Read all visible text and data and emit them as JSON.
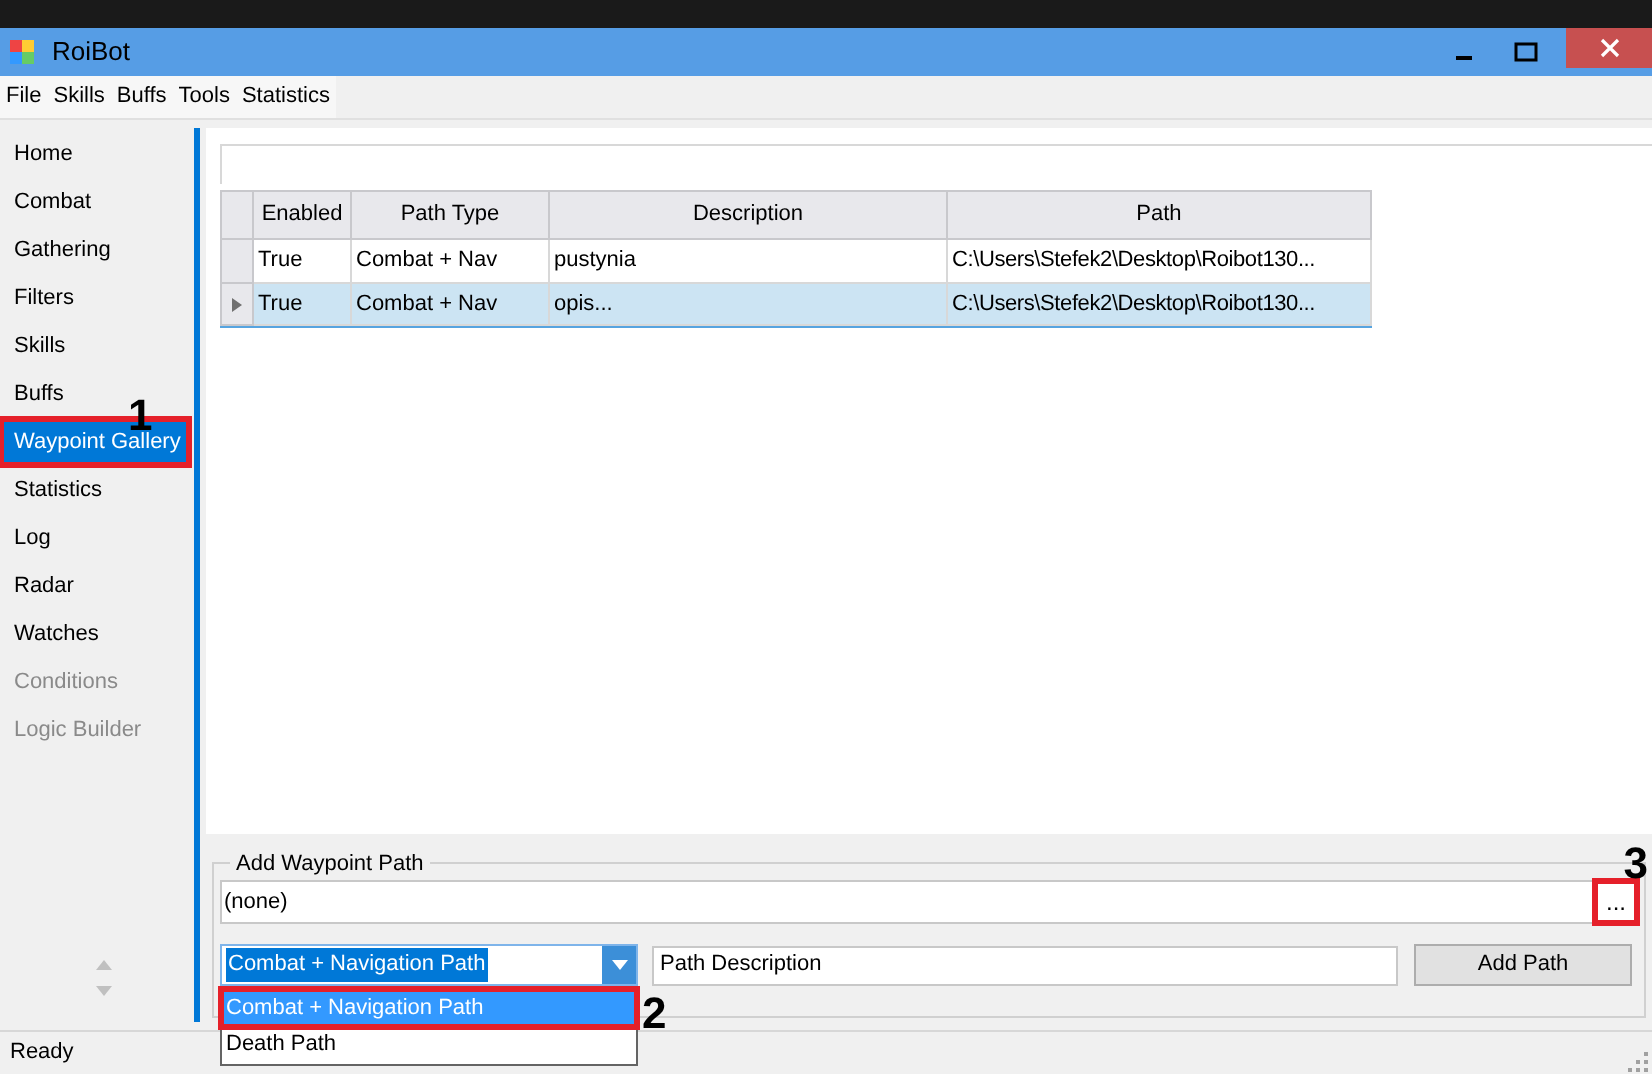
{
  "window": {
    "title": "RoiBot"
  },
  "menu": [
    "File",
    "Skills",
    "Buffs",
    "Tools",
    "Statistics"
  ],
  "sidebar": {
    "items": [
      {
        "label": "Home",
        "selected": false,
        "disabled": false
      },
      {
        "label": "Combat",
        "selected": false,
        "disabled": false
      },
      {
        "label": "Gathering",
        "selected": false,
        "disabled": false
      },
      {
        "label": "Filters",
        "selected": false,
        "disabled": false
      },
      {
        "label": "Skills",
        "selected": false,
        "disabled": false
      },
      {
        "label": "Buffs",
        "selected": false,
        "disabled": false
      },
      {
        "label": "Waypoint Gallery",
        "selected": true,
        "disabled": false,
        "annotation": "1"
      },
      {
        "label": "Statistics",
        "selected": false,
        "disabled": false
      },
      {
        "label": "Log",
        "selected": false,
        "disabled": false
      },
      {
        "label": "Radar",
        "selected": false,
        "disabled": false
      },
      {
        "label": "Watches",
        "selected": false,
        "disabled": false
      },
      {
        "label": "Conditions",
        "selected": false,
        "disabled": true
      },
      {
        "label": "Logic Builder",
        "selected": false,
        "disabled": true
      }
    ]
  },
  "table": {
    "columns": [
      "Enabled",
      "Path Type",
      "Description",
      "Path"
    ],
    "rows": [
      {
        "selected": false,
        "cells": [
          "True",
          "Combat + Nav",
          "pustynia",
          "C:\\Users\\Stefek2\\Desktop\\Roibot130..."
        ]
      },
      {
        "selected": true,
        "cells": [
          "True",
          "Combat + Nav",
          "opis...",
          "C:\\Users\\Stefek2\\Desktop\\Roibot130..."
        ]
      }
    ]
  },
  "add_waypoint_path": {
    "title": "Add Waypoint Path",
    "path_value": "(none)",
    "browse_button": {
      "label": "...",
      "annotation": "3"
    },
    "path_type": {
      "value": "Combat + Navigation Path",
      "expanded": true,
      "options": [
        {
          "label": "Combat + Navigation Path",
          "selected": true,
          "annotation": "2"
        },
        {
          "label": "Death Path",
          "selected": false
        }
      ]
    },
    "description_value": "Path Description",
    "add_button": "Add Path"
  },
  "status_bar": "Ready"
}
